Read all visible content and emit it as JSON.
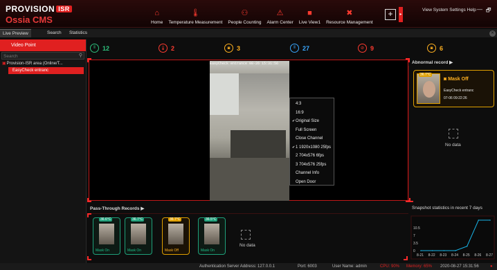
{
  "app": {
    "logo_brand": "PROVISION",
    "logo_badge": "ISR",
    "logo_sub": "Ossia CMS",
    "menu": "View System Settings Help",
    "minimize": "—",
    "restore": "🗗"
  },
  "nav": [
    {
      "label": "Home",
      "icon": "home-icon",
      "glyph": "⌂"
    },
    {
      "label": "Temperature Measurement",
      "icon": "thermometer-icon",
      "glyph": "🌡"
    },
    {
      "label": "People Counting",
      "icon": "people-counting-icon",
      "glyph": "⚇"
    },
    {
      "label": "Alarm Center",
      "icon": "alarm-icon",
      "glyph": "⚠"
    },
    {
      "label": "Live View1",
      "icon": "camera-icon",
      "glyph": "■"
    },
    {
      "label": "Resource Management",
      "icon": "tools-icon",
      "glyph": "✖"
    }
  ],
  "tabs": [
    "Live Preview",
    "Search",
    "Statistics"
  ],
  "left": {
    "header": "Video Point",
    "search_placeholder": "Search",
    "tree_root": "Provision-ISR area (Online/T...",
    "tree_child": "EasyCheck entranc"
  },
  "stats": [
    {
      "icon": "pass-icon",
      "glyph": "⦀",
      "value": "12",
      "color": "#2ec27e"
    },
    {
      "icon": "temperature-alert-icon",
      "glyph": "🌡",
      "value": "2",
      "color": "#ff3b30"
    },
    {
      "icon": "mask-icon",
      "glyph": "◙",
      "value": "3",
      "color": "#ffb020"
    },
    {
      "icon": "total-icon",
      "glyph": "⦀",
      "value": "27",
      "color": "#3aa8ff"
    },
    {
      "icon": "no-entry-icon",
      "glyph": "⊘",
      "value": "9",
      "color": "#ff3b30"
    },
    {
      "icon": "no-mask-icon",
      "glyph": "◙",
      "value": "6",
      "color": "#ffb020"
    }
  ],
  "video": {
    "osd": "EasyCheck entrance 08-26 15:31:56"
  },
  "context_menu": [
    {
      "label": "4:3",
      "checked": ""
    },
    {
      "label": "16:9",
      "checked": ""
    },
    {
      "label": "Original Size",
      "checked": "✔"
    },
    {
      "label": "Full Screen",
      "checked": ""
    },
    {
      "label": "Close Channel",
      "checked": ""
    },
    {
      "label": "1 1920x1080 25fps",
      "checked": "✔"
    },
    {
      "label": "2 704x576 6fps",
      "checked": ""
    },
    {
      "label": "3 704x576 25fps",
      "checked": ""
    },
    {
      "label": "Channel Info",
      "checked": ""
    },
    {
      "label": "Open Door",
      "checked": ""
    }
  ],
  "abnormal": {
    "title": "Abnormal record ▶",
    "temp": "36.7°C",
    "label": "Mask Off",
    "device": "EasyCheck entranc",
    "time": "07-06 09:22:26",
    "no_data": "No data"
  },
  "pass_through": {
    "title": "Pass-Through Records ▶",
    "cards": [
      {
        "temp": "36.6°C",
        "mask": "Mask On",
        "warn": false
      },
      {
        "temp": "36.7°C",
        "mask": "Mask On",
        "warn": false
      },
      {
        "temp": "36.7°C",
        "mask": "Mask Off",
        "warn": true
      },
      {
        "temp": "36.5°C",
        "mask": "Mask On",
        "warn": false
      }
    ],
    "no_data": "No data"
  },
  "snapshot": {
    "title": "Snapshot statistics in recent 7 days"
  },
  "chart_data": {
    "type": "line",
    "categories": [
      "8-21",
      "8-22",
      "8-23",
      "8-24",
      "8-25",
      "8-26",
      "8-27"
    ],
    "values": [
      0,
      0,
      0,
      0,
      2,
      14,
      14
    ],
    "yticks": [
      "0",
      "3.5",
      "7",
      "10.5"
    ],
    "ylim": [
      0,
      14
    ],
    "color": "#18b4e8"
  },
  "status": {
    "auth": "Authentication Server Address: 127.0.0.1",
    "port": "Port: 6003",
    "user": "User Name: admin",
    "cpu": "CPU: 90%",
    "memory": "Memory: 65%",
    "datetime": "2020-08-27 15:31:56"
  }
}
